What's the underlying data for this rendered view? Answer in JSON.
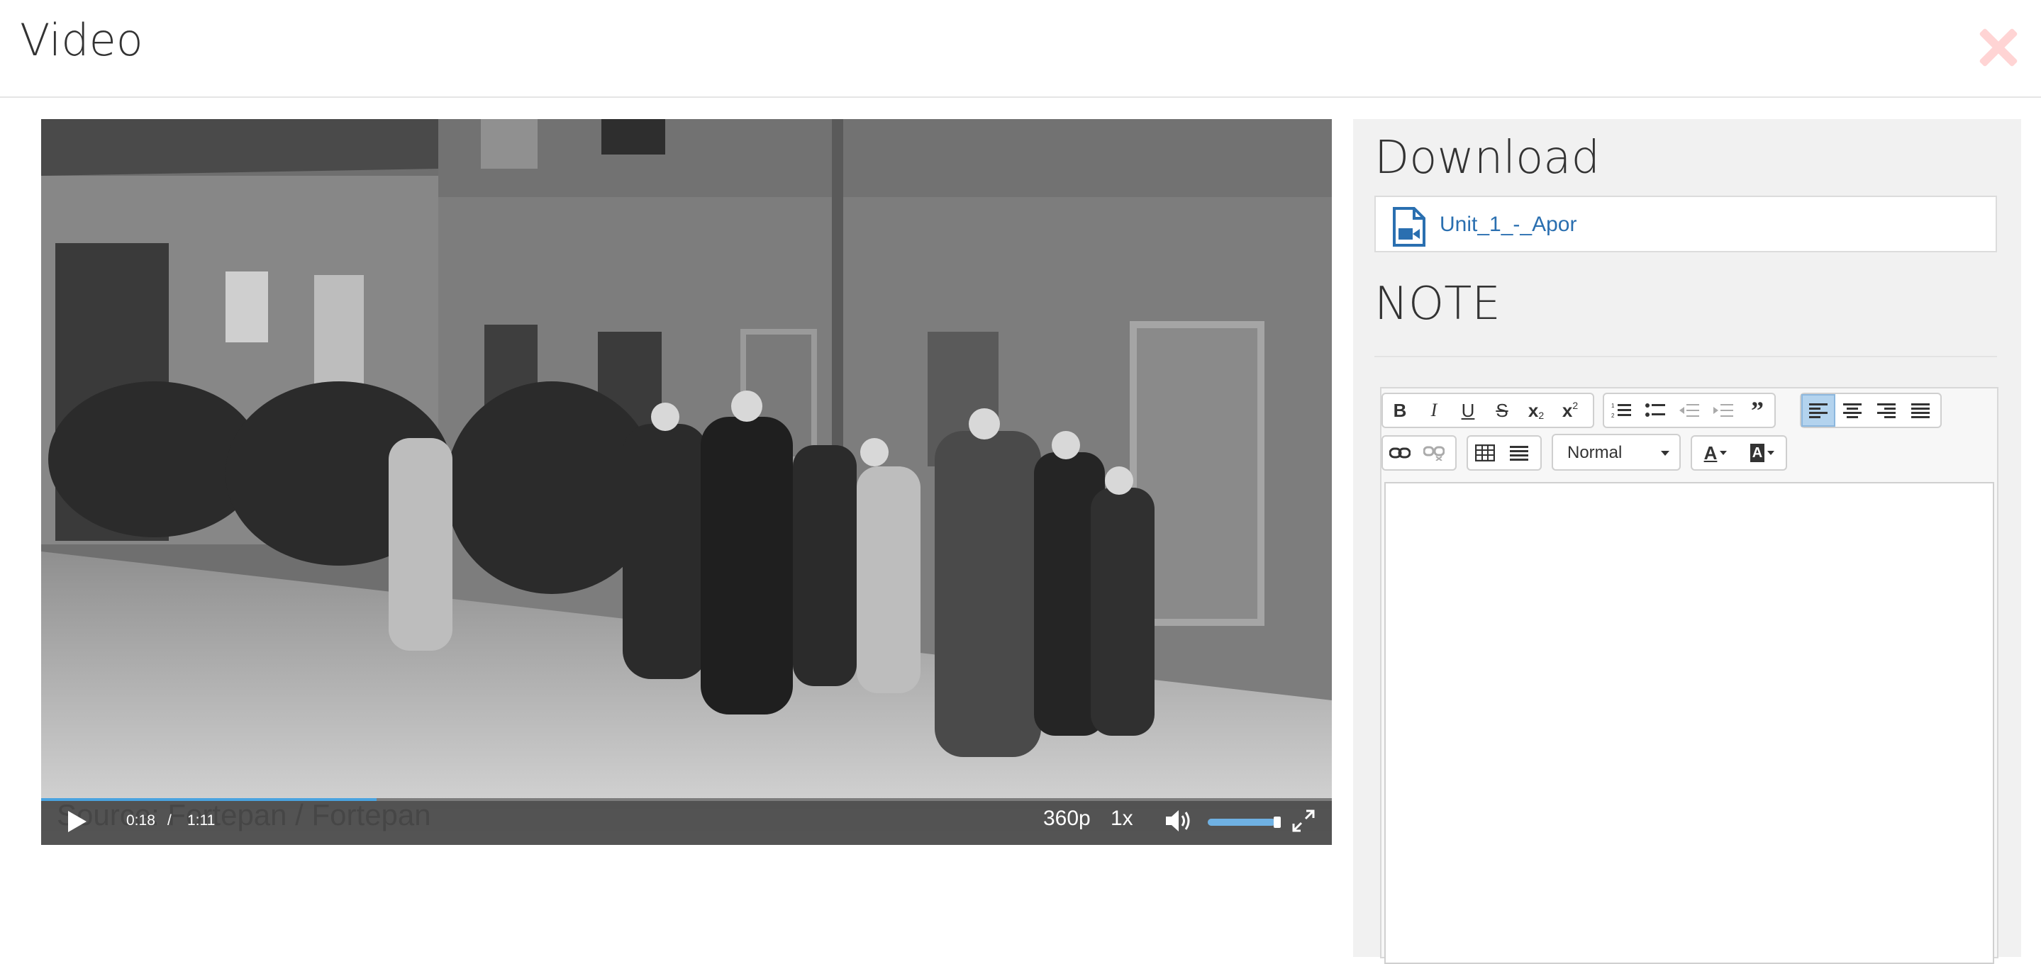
{
  "header": {
    "title": "Video"
  },
  "video": {
    "watermark": "Source: Fortepan / Fortepan",
    "current_time": "0:18",
    "time_separator": "/",
    "duration": "1:11",
    "progress": 0.26,
    "quality": "360p",
    "speed": "1x",
    "volume": 0.95
  },
  "download": {
    "heading": "Download",
    "file_name": "Unit_1_-_Apor"
  },
  "note": {
    "heading": "NOTE",
    "format_select": "Normal",
    "text": ""
  },
  "colors": {
    "accent": "#2a6fb0",
    "progress": "#4aa3df",
    "close": "#ffd4d4",
    "active_tool": "#b3d3ee"
  }
}
